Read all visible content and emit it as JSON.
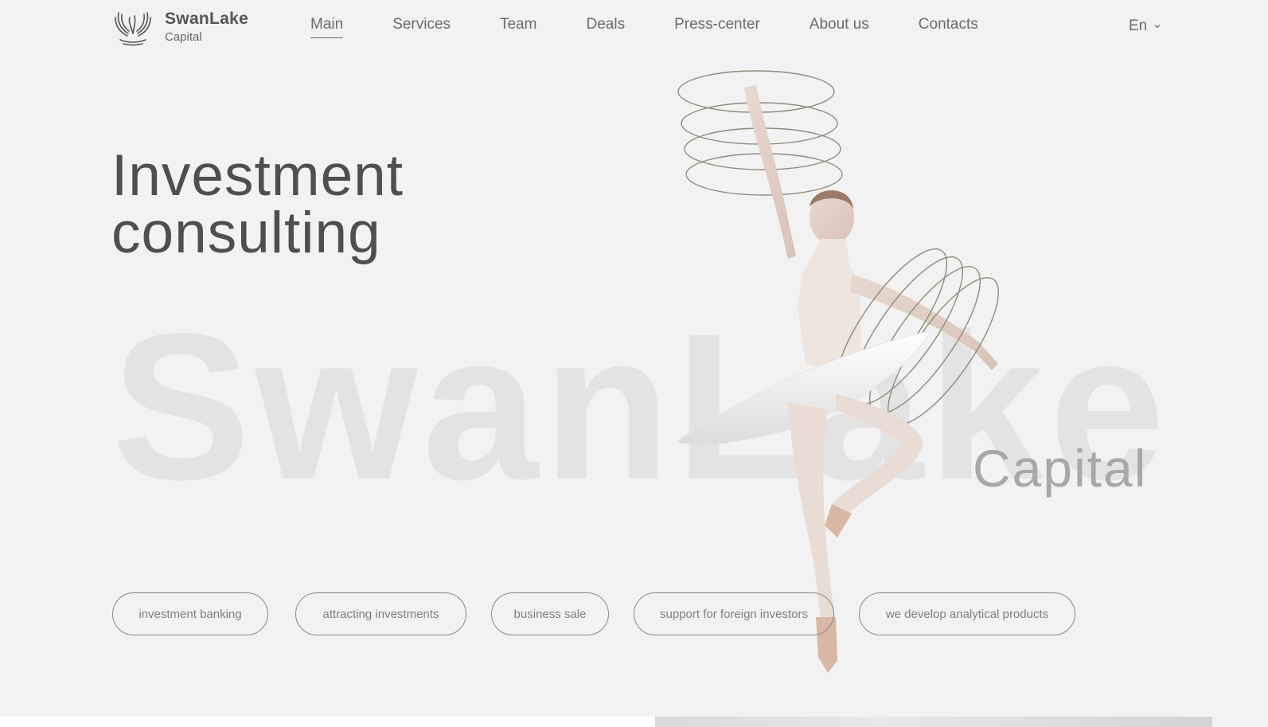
{
  "brand": {
    "name": "SwanLake",
    "sub": "Capital"
  },
  "nav": {
    "items": [
      {
        "label": "Main",
        "active": true
      },
      {
        "label": "Services"
      },
      {
        "label": "Team"
      },
      {
        "label": "Deals"
      },
      {
        "label": "Press-center"
      },
      {
        "label": "About us"
      },
      {
        "label": "Contacts"
      }
    ],
    "language": "En"
  },
  "hero": {
    "title_line1": "Investment",
    "title_line2": "consulting",
    "watermark": "SwanLake",
    "watermark_sub": "Capital"
  },
  "services": [
    "investment banking",
    "attracting investments",
    "business sale",
    "support for foreign investors",
    "we develop analytical products"
  ],
  "colors": {
    "background": "#f2f2f2",
    "text": "#5a5a5a",
    "pill_border": "#8a8a7e",
    "watermark": "#e3e3e3"
  }
}
